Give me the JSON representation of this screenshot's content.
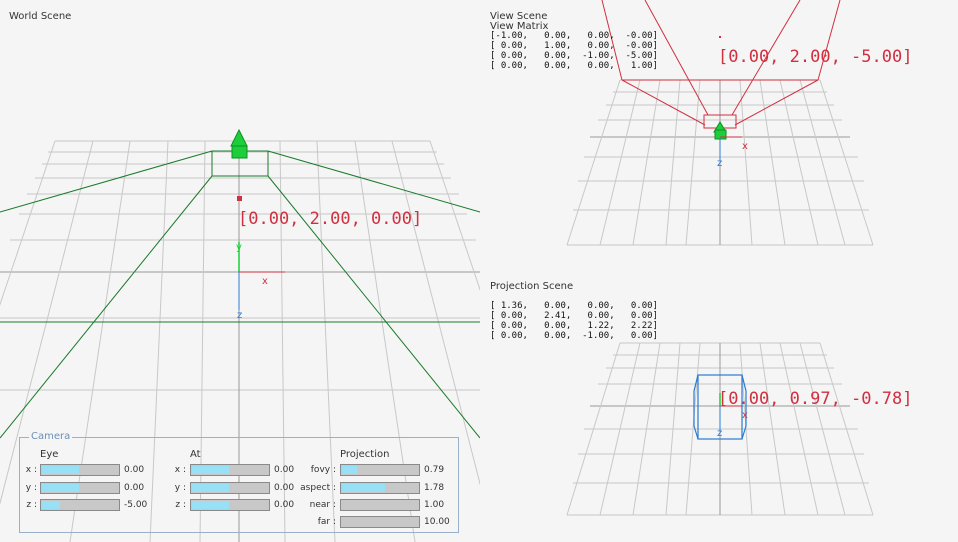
{
  "world": {
    "title": "World Scene",
    "label": "[0.00, 2.00, 0.00]",
    "axes": {
      "x": "x",
      "y": "y",
      "z": "z"
    }
  },
  "view": {
    "title": "View Scene",
    "matrix_title": "View Matrix",
    "matrix": [
      "[-1.00,   0.00,   0.00,  -0.00]",
      "[ 0.00,   1.00,   0.00,  -0.00]",
      "[ 0.00,   0.00,  -1.00,  -5.00]",
      "[ 0.00,   0.00,   0.00,   1.00]"
    ],
    "label": "[0.00, 2.00, -5.00]",
    "axes": {
      "x": "x",
      "z": "z"
    }
  },
  "projection": {
    "title": "Projection Scene",
    "matrix": [
      "[ 1.36,   0.00,   0.00,   0.00]",
      "[ 0.00,   2.41,   0.00,   0.00]",
      "[ 0.00,   0.00,   1.22,   2.22]",
      "[ 0.00,   0.00,  -1.00,   0.00]"
    ],
    "label": "[0.00, 0.97, -0.78]",
    "axes": {
      "x": "x",
      "z": "z"
    }
  },
  "camera": {
    "legend": "Camera",
    "eye": {
      "title": "Eye",
      "rows": [
        {
          "label": "x :",
          "value": "0.00",
          "level": 0.5
        },
        {
          "label": "y :",
          "value": "0.00",
          "level": 0.5
        },
        {
          "label": "z :",
          "value": "-5.00",
          "level": 0.25
        }
      ]
    },
    "at": {
      "title": "At",
      "rows": [
        {
          "label": "x :",
          "value": "0.00",
          "level": 0.5
        },
        {
          "label": "y :",
          "value": "0.00",
          "level": 0.5
        },
        {
          "label": "z :",
          "value": "0.00",
          "level": 0.5
        }
      ]
    },
    "projection": {
      "title": "Projection",
      "rows": [
        {
          "label": "fovy :",
          "value": "0.79",
          "level": 0.22
        },
        {
          "label": "aspect :",
          "value": "1.78",
          "level": 0.58
        },
        {
          "label": "near :",
          "value": "1.00",
          "level": 0.0
        },
        {
          "label": "far :",
          "value": "10.00",
          "level": 0.0
        }
      ]
    }
  },
  "colors": {
    "grid": "#c8c8c8",
    "frustum_world": "#1a7a2a",
    "frustum_view": "#d03040",
    "projection_box": "#2a7ad0",
    "label": "#d03040",
    "slider_fill": "#97e0f5"
  }
}
